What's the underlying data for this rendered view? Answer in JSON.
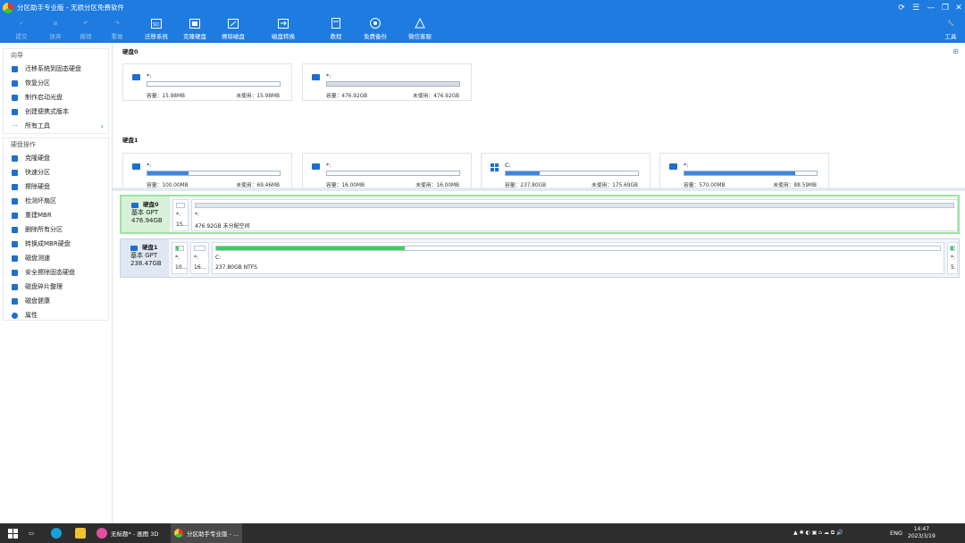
{
  "window": {
    "title": "分区助手专业版 - 无损分区免费软件"
  },
  "toolbar": {
    "commit": "提交",
    "discard": "放弃",
    "undo": "撤销",
    "redo": "重做",
    "migrate": "迁移系统",
    "clone": "克隆硬盘",
    "wipe": "擦除磁盘",
    "convert": "磁盘转换",
    "tutorial": "教程",
    "backup": "免费备份",
    "wechat": "微信客服",
    "tools": "工具"
  },
  "sidebar": {
    "wizard_title": "向导",
    "wizard_items": [
      "迁移系统到固态硬盘",
      "恢复分区",
      "制作启动光盘",
      "创建便携式版本",
      "所有工具"
    ],
    "ops_title": "硬盘操作",
    "ops_items": [
      "克隆硬盘",
      "快速分区",
      "擦除硬盘",
      "检测坏扇区",
      "重建MBR",
      "删除所有分区",
      "转换成MBR硬盘",
      "磁盘测速",
      "安全擦除固态硬盘",
      "磁盘碎片整理",
      "磁盘健康",
      "属性"
    ]
  },
  "disk0": {
    "title": "硬盘0",
    "cards": [
      {
        "name": "*:",
        "cap": "容量：15.98MB",
        "free": "未使用：15.98MB",
        "used": 0.0
      },
      {
        "name": "*:",
        "cap": "容量：476.92GB",
        "free": "未使用：476.92GB",
        "used": 0.0
      }
    ]
  },
  "disk1": {
    "title": "硬盘1",
    "cards": [
      {
        "name": "*:",
        "cap": "容量：100.00MB",
        "free": "未使用：69.46MB",
        "used": 0.31
      },
      {
        "name": "*:",
        "cap": "容量：16.00MB",
        "free": "未使用：16.00MB",
        "used": 0.0
      },
      {
        "name": "C:",
        "cap": "容量：237.80GB",
        "free": "未使用：175.69GB",
        "used": 0.26
      },
      {
        "name": "*:",
        "cap": "容量：570.00MB",
        "free": "未使用：88.59MB",
        "used": 0.84
      }
    ]
  },
  "map": {
    "row0": {
      "name": "硬盘0",
      "type": "基本 GPT",
      "size": "476.94GB",
      "parts": [
        {
          "name": "*:",
          "desc": "15..."
        },
        {
          "name": "*:",
          "desc": "476.92GB 未分配空间"
        }
      ]
    },
    "row1": {
      "name": "硬盘1",
      "type": "基本 GPT",
      "size": "238.47GB",
      "parts": [
        {
          "name": "*:",
          "desc": "10..."
        },
        {
          "name": "*:",
          "desc": "16..."
        },
        {
          "name": "C:",
          "desc": "237.80GB NTFS"
        },
        {
          "name": "*:",
          "desc": "5."
        }
      ]
    }
  },
  "taskbar": {
    "app1": "无标题* - 画图 3D",
    "app2": "分区助手专业版 - ...",
    "lang": "ENG",
    "time": "14:47",
    "date": "2023/3/19"
  },
  "colors": {
    "accent": "#1e7be0",
    "bar": "#3d86df",
    "green": "#3ccf5a"
  }
}
